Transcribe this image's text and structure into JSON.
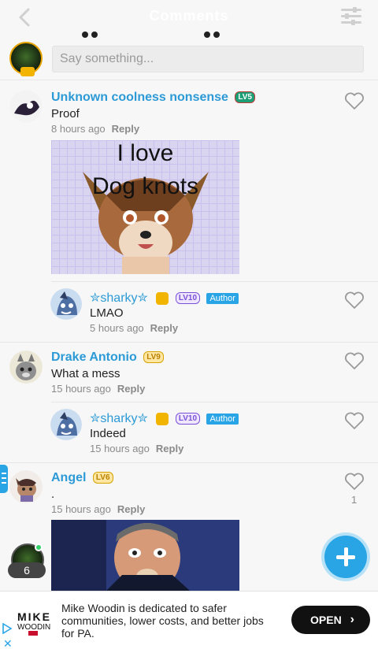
{
  "header": {
    "title": "Comments"
  },
  "compose": {
    "placeholder": "Say something..."
  },
  "comments": [
    {
      "name": "Unknown coolness nonsense",
      "level": "LV5",
      "text": "Proof",
      "time": "8 hours ago",
      "reply": "Reply",
      "image_caption_1": "I love",
      "image_caption_2": "Dog knots"
    },
    {
      "name": "✮sharky✮",
      "level": "LV10",
      "author_badge": "Author",
      "text": "LMAO",
      "time": "5 hours ago",
      "reply": "Reply"
    },
    {
      "name": "Drake Antonio",
      "level": "LV9",
      "text": "What a mess",
      "time": "15 hours ago",
      "reply": "Reply"
    },
    {
      "name": "✮sharky✮",
      "level": "LV10",
      "author_badge": "Author",
      "text": "Indeed",
      "time": "15 hours ago",
      "reply": "Reply"
    },
    {
      "name": "Angel",
      "level": "LV6",
      "text": ".",
      "time": "15 hours ago",
      "reply": "Reply",
      "likes": "1"
    }
  ],
  "floating": {
    "online_count": "6"
  },
  "ad": {
    "brand_line_1": "MIKE",
    "brand_line_2": "WOODIN",
    "copy": "Mike Woodin is dedicated to safer communities, lower costs, and better jobs for PA.",
    "cta": "OPEN"
  },
  "colors": {
    "accent": "#29a5e6",
    "name": "#2b9ad6"
  }
}
